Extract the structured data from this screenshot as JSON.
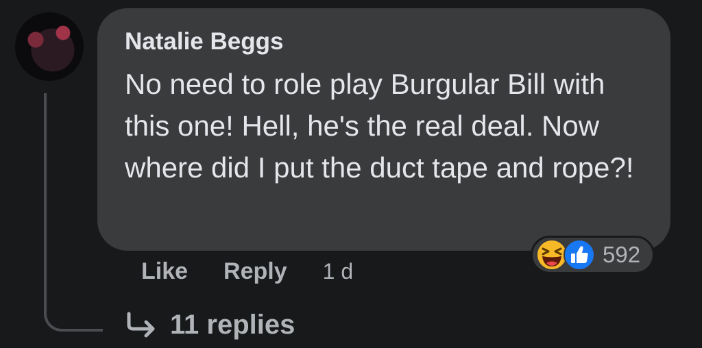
{
  "comment": {
    "author": "Natalie Beggs",
    "text": "No need to role play Burgular Bill with this one! Hell, he's the real deal. Now where did I put the duct tape and rope?!",
    "reactions": {
      "icons": [
        "laughing-face-icon",
        "thumbs-up-icon"
      ],
      "count": "592",
      "colors": {
        "haha": "#f7b928",
        "like": "#1877f2"
      }
    },
    "actions": {
      "like_label": "Like",
      "reply_label": "Reply",
      "timestamp": "1 d"
    },
    "replies_label": "11 replies"
  },
  "colors": {
    "background": "#18191b",
    "bubble": "#3a3b3c",
    "primary_text": "#e4e6eb",
    "secondary_text": "#b0b3b8",
    "thread_line": "#4a4c50"
  }
}
